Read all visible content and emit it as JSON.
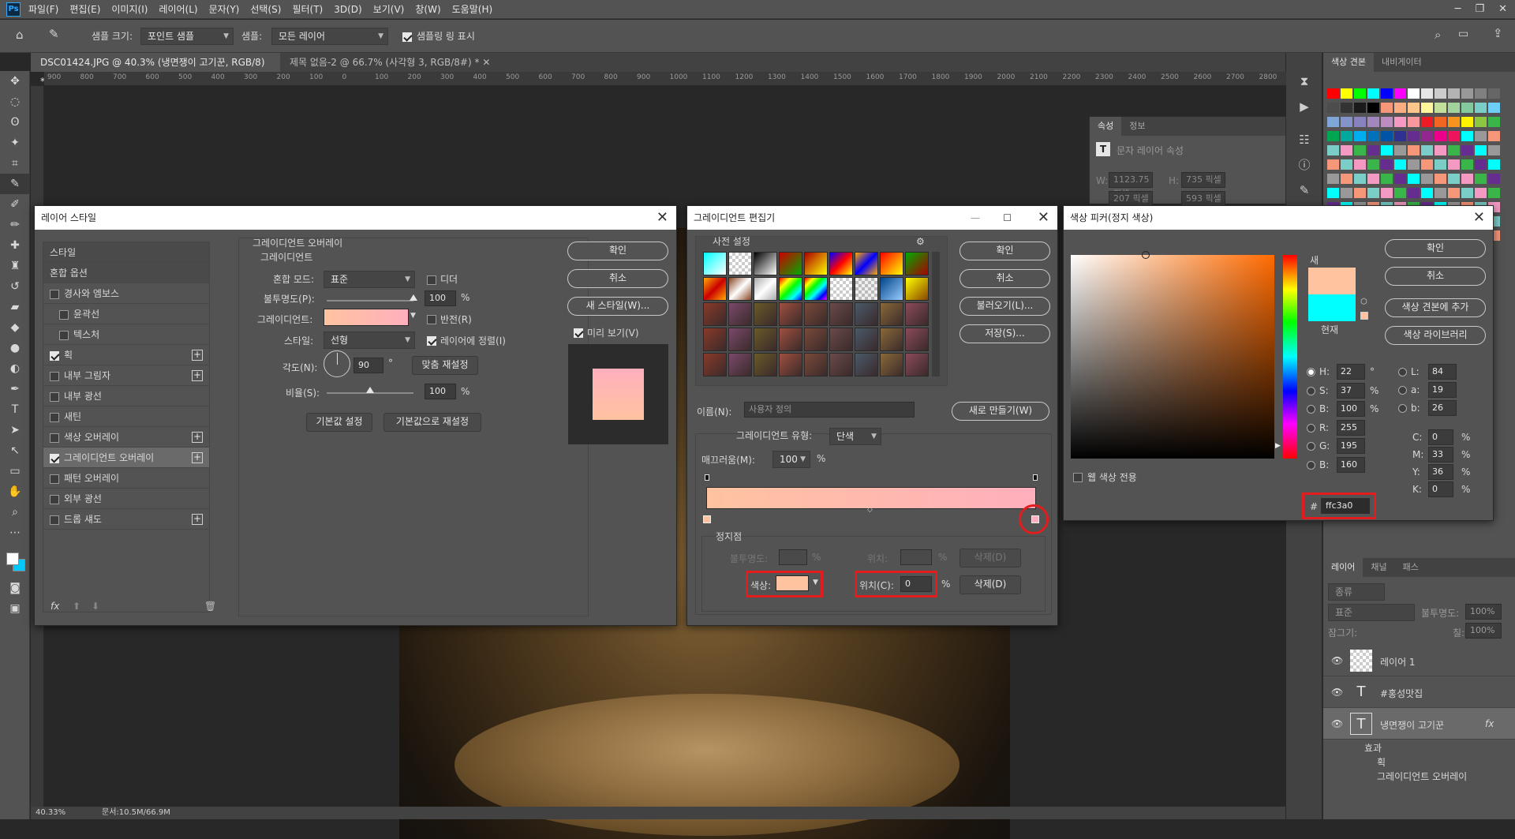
{
  "menubar": {
    "logo": "Ps",
    "items": [
      "파일(F)",
      "편집(E)",
      "이미지(I)",
      "레이어(L)",
      "문자(Y)",
      "선택(S)",
      "필터(T)",
      "3D(D)",
      "보기(V)",
      "창(W)",
      "도움말(H)"
    ],
    "win_minimize": "─",
    "win_restore": "❐",
    "win_close": "✕"
  },
  "options": {
    "sample_size_label": "샘플 크기:",
    "sample_size_value": "포인트 샘플",
    "sample_label": "샘플:",
    "sample_value": "모든 레이어",
    "show_ring_label": "샘플링 링 표시"
  },
  "doc_tabs": [
    "DSC01424.JPG @ 40.3% (냉면쟁이 고기꾼, RGB/8) *",
    "제목 없음-2 @ 66.7% (사각형 3, RGB/8#) *"
  ],
  "ruler_ticks": [
    "900",
    "800",
    "700",
    "600",
    "500",
    "400",
    "300",
    "200",
    "100",
    "0",
    "100",
    "200",
    "300",
    "400",
    "500",
    "600",
    "700",
    "800",
    "900",
    "1000",
    "1100",
    "1200",
    "1300",
    "1400",
    "1500",
    "1600",
    "1700",
    "1800",
    "1900",
    "2000",
    "2100",
    "2200",
    "2300",
    "2400",
    "2500",
    "2600",
    "2700",
    "2800"
  ],
  "status": {
    "zoom": "40.33%",
    "doc": "문서:10.5M/66.9M"
  },
  "properties": {
    "tabs": [
      "속성",
      "정보"
    ],
    "type_label": "문자 레이어 속성",
    "w_label": "W:",
    "w_value": "1123.75 픽셀",
    "h_label": "H:",
    "h_value": "735 픽셀",
    "x_value": "207 픽셀",
    "y_value": "593 픽셀"
  },
  "swatches_panel": {
    "tabs": [
      "색상 견본",
      "내비게이터"
    ],
    "colors": [
      "#ff0000",
      "#ffff00",
      "#00ff00",
      "#00ffff",
      "#0000ff",
      "#ff00ff",
      "#ffffff",
      "#e6e6e6",
      "#cccccc",
      "#b3b3b3",
      "#999999",
      "#808080",
      "#666666",
      "#4d4d4d",
      "#333333",
      "#1a1a1a",
      "#000000",
      "#f7977a",
      "#f9ad81",
      "#fdc68a",
      "#fff79a",
      "#c4df9b",
      "#a2d39c",
      "#82ca9d",
      "#7bcdc8",
      "#6ecff6",
      "#7ea7d8",
      "#8493ca",
      "#8882be",
      "#a187be",
      "#bc8dbf",
      "#f49ac2",
      "#f6989d",
      "#ed1c24",
      "#f26522",
      "#f7941d",
      "#fff200",
      "#8dc73f",
      "#39b54a",
      "#00a651",
      "#00a99d",
      "#00aeef",
      "#0072bc",
      "#0054a6",
      "#2e3192",
      "#662d91",
      "#92278f",
      "#ec008c",
      "#ed145b"
    ]
  },
  "layers_panel": {
    "tabs": [
      "레이어",
      "채널",
      "패스"
    ],
    "kind_label": "종류",
    "blend_value": "표준",
    "opacity_label": "불투명도:",
    "opacity_value": "100%",
    "lock_label": "잠그기:",
    "fill_label": "칠:",
    "fill_value": "100%",
    "layers": [
      {
        "name": "레이어 1",
        "thumb": "checker"
      },
      {
        "name": "#홍성맛집",
        "thumb": "T"
      },
      {
        "name": "냉면쟁이 고기꾼",
        "thumb": "T",
        "fx": "fx"
      }
    ],
    "effects_label": "효과",
    "effect_items": [
      "획",
      "그레이디언트 오버레이"
    ]
  },
  "layer_style": {
    "title": "레이어 스타일",
    "close": "✕",
    "side_items": [
      {
        "label": "스타일",
        "check": false,
        "header": true,
        "plus": false
      },
      {
        "label": "혼합 옵션",
        "check": false,
        "header": true,
        "plus": false
      },
      {
        "label": "경사와 엠보스",
        "check": false,
        "plus": false
      },
      {
        "label": "윤곽선",
        "check": false,
        "plus": false,
        "indent": true
      },
      {
        "label": "텍스처",
        "check": false,
        "plus": false,
        "indent": true
      },
      {
        "label": "획",
        "check": true,
        "plus": true
      },
      {
        "label": "내부 그림자",
        "check": false,
        "plus": true
      },
      {
        "label": "내부 광선",
        "check": false,
        "plus": false
      },
      {
        "label": "새틴",
        "check": false,
        "plus": false
      },
      {
        "label": "색상 오버레이",
        "check": false,
        "plus": true
      },
      {
        "label": "그레이디언트 오버레이",
        "check": true,
        "plus": true,
        "selected": true
      },
      {
        "label": "패턴 오버레이",
        "check": false,
        "plus": false
      },
      {
        "label": "외부 광선",
        "check": false,
        "plus": false
      },
      {
        "label": "드롭 섀도",
        "check": false,
        "plus": true
      }
    ],
    "fx_label": "fx",
    "section_title": "그레이디언트 오버레이",
    "sub_title": "그레이디언트",
    "blend_mode_label": "혼합 모드:",
    "blend_mode_value": "표준",
    "dither_label": "디더",
    "opacity_label": "불투명도(P):",
    "opacity_value": "100",
    "opacity_fill": 1.0,
    "percent": "%",
    "gradient_label": "그레이디언트:",
    "reverse_label": "반전(R)",
    "style_label": "스타일:",
    "style_value": "선형",
    "align_label": "레이어에 정렬(I)",
    "angle_label": "각도(N):",
    "angle_value": "90",
    "degree": "°",
    "reset_align": "맞춤 재설정",
    "scale_label": "비율(S):",
    "scale_value": "100",
    "scale_fill": 0.5,
    "default_btn": "기본값 설정",
    "reset_default_btn": "기본값으로 재설정",
    "ok": "확인",
    "cancel": "취소",
    "new_style": "새 스타일(W)...",
    "preview_label": "미리 보기(V)",
    "gradient_start": "#ffc3a0",
    "gradient_end": "#ffafbd"
  },
  "gradient_editor": {
    "title": "그레이디언트 편집기",
    "presets_label": "사전 설정",
    "ok": "확인",
    "cancel": "취소",
    "load": "불러오기(L)...",
    "save": "저장(S)...",
    "name_label": "이름(N):",
    "name_value": "사용자 정의",
    "new_btn": "새로 만들기(W)",
    "type_label": "그레이디언트 유형:",
    "type_value": "단색",
    "smooth_label": "매끄러움(M):",
    "smooth_value": "100",
    "percent": "%",
    "stops_label": "정지점",
    "stop_opacity_label": "불투명도:",
    "location_label": "위치:",
    "delete_label": "삭제(D)",
    "color_label": "색상:",
    "color_location_label": "위치(C):",
    "color_location_value": "0",
    "stop_color": "#ffc3a0",
    "bar_start": "#ffc3a0",
    "bar_end": "#ffafbd"
  },
  "color_picker": {
    "title": "색상 피커(정지 색상)",
    "new_label": "새",
    "current_label": "현재",
    "new_color": "#ffc3a0",
    "current_color": "#00ffff",
    "ok": "확인",
    "cancel": "취소",
    "add_swatch": "색상 견본에 추가",
    "color_library": "색상 라이브러리",
    "web_only": "웹 색상 전용",
    "hue_marker": 0.06,
    "fields": [
      {
        "label": "H:",
        "value": "22",
        "unit": "°",
        "on": true
      },
      {
        "label": "S:",
        "value": "37",
        "unit": "%"
      },
      {
        "label": "B:",
        "value": "100",
        "unit": "%"
      },
      {
        "label": "R:",
        "value": "255",
        "unit": ""
      },
      {
        "label": "G:",
        "value": "195",
        "unit": ""
      },
      {
        "label": "B:",
        "value": "160",
        "unit": ""
      }
    ],
    "lab": [
      {
        "label": "L:",
        "value": "84"
      },
      {
        "label": "a:",
        "value": "19"
      },
      {
        "label": "b:",
        "value": "26"
      }
    ],
    "cmyk": [
      {
        "label": "C:",
        "value": "0",
        "unit": "%"
      },
      {
        "label": "M:",
        "value": "33",
        "unit": "%"
      },
      {
        "label": "Y:",
        "value": "36",
        "unit": "%"
      },
      {
        "label": "K:",
        "value": "0",
        "unit": "%"
      }
    ],
    "hex_label": "#",
    "hex_value": "ffc3a0"
  }
}
